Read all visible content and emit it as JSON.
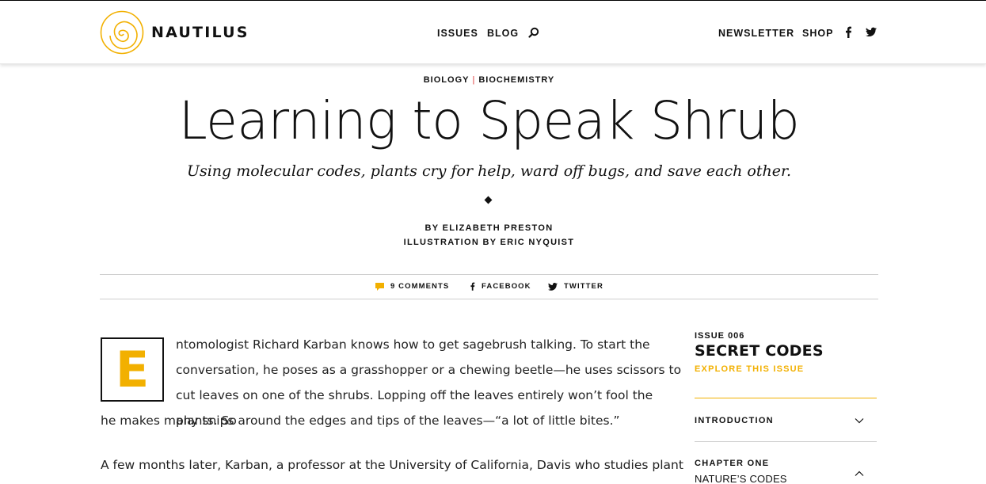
{
  "brand": {
    "name": "NAUTILUS",
    "logo_icon": "nautilus-spiral-icon",
    "accent": "#f2b000"
  },
  "nav": {
    "issues": "ISSUES",
    "blog": "BLOG",
    "search_icon": "search-icon",
    "newsletter": "NEWSLETTER",
    "shop": "SHOP",
    "facebook_icon": "facebook-icon",
    "twitter_icon": "twitter-icon"
  },
  "article": {
    "category_1": "BIOLOGY",
    "category_sep": "|",
    "category_2": "BIOCHEMISTRY",
    "title": "Learning to Speak Shrub",
    "subtitle": "Using molecular codes, plants cry for help, ward off bugs, and save each other.",
    "byline": "BY ELIZABETH PRESTON",
    "illustration": "ILLUSTRATION BY ERIC NYQUIST",
    "dropcap": "E",
    "para1_top": "ntomologist Richard Karban knows how to get sagebrush talking. To start the conversation, he poses as a grasshopper or a chewing beetle—he uses scissors to cut leaves on one of the shrubs. Lopping off the leaves entirely won’t fool the plants. So",
    "para1_bottom": "he makes many snips around the edges and tips of the leaves—“a lot of little bites.”",
    "para2": "A few months later, Karban, a professor at the University of California, Davis who studies plant"
  },
  "share": {
    "comments": "9 COMMENTS",
    "facebook": "FACEBOOK",
    "twitter": "TWITTER"
  },
  "sidebar": {
    "issue_label": "ISSUE 006",
    "issue_title": "SECRET CODES",
    "explore": "EXPLORE THIS ISSUE",
    "intro": "INTRODUCTION",
    "chapter_label": "CHAPTER ONE",
    "chapter_title": "NATURE’S CODES"
  }
}
